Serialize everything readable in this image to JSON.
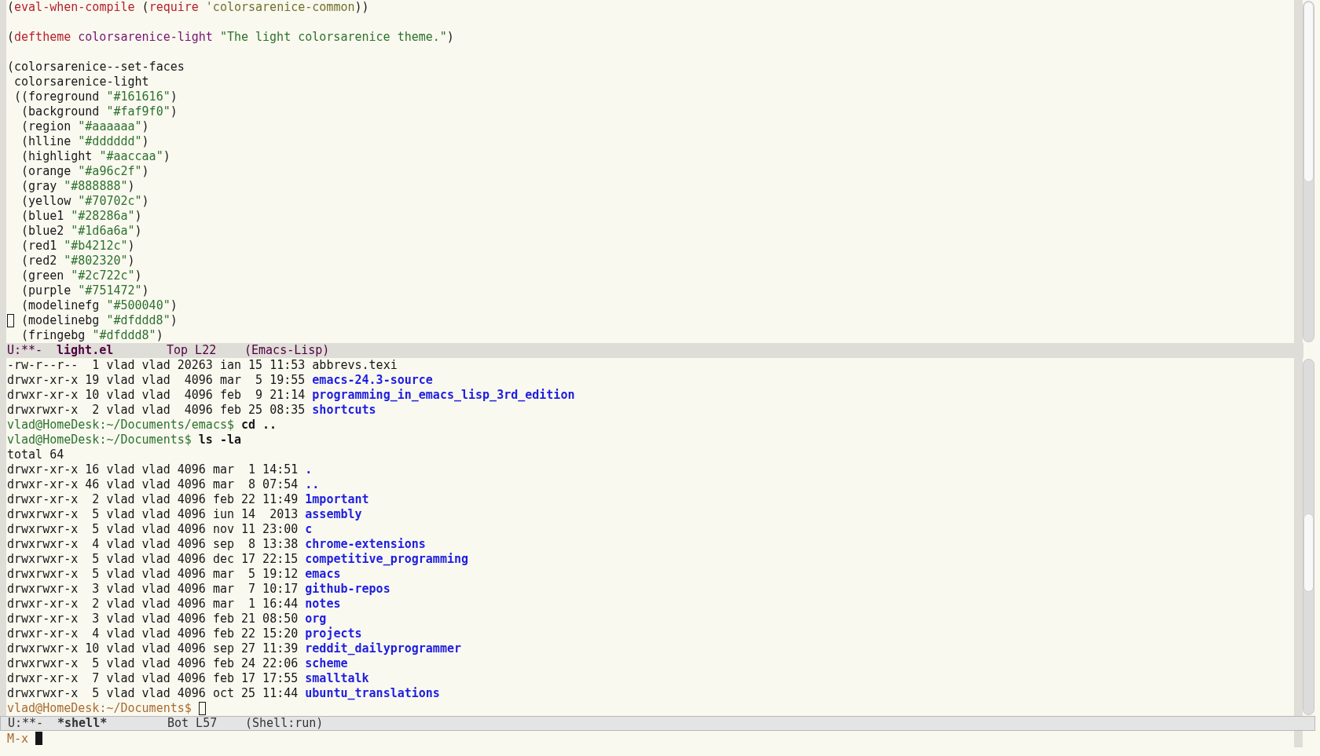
{
  "editor": {
    "lines": [
      {
        "kind": "code",
        "tokens": [
          {
            "kind": "plain",
            "text": "("
          },
          {
            "kind": "keyword",
            "text": "eval-when-compile"
          },
          {
            "kind": "plain",
            "text": " ("
          },
          {
            "kind": "keyword",
            "text": "require"
          },
          {
            "kind": "space"
          },
          {
            "kind": "quoted",
            "text": "'colorsarenice-common"
          },
          {
            "kind": "plain",
            "text": "))"
          }
        ]
      },
      {
        "kind": "blank"
      },
      {
        "kind": "code",
        "tokens": [
          {
            "kind": "plain",
            "text": "("
          },
          {
            "kind": "keyword",
            "text": "deftheme"
          },
          {
            "kind": "space"
          },
          {
            "kind": "name",
            "text": "colorsarenice-light"
          },
          {
            "kind": "space"
          },
          {
            "kind": "string",
            "text": "\"The light colorsarenice theme.\""
          },
          {
            "kind": "plain",
            "text": ")"
          }
        ]
      },
      {
        "kind": "blank"
      },
      {
        "kind": "code",
        "tokens": [
          {
            "kind": "plain",
            "text": "(colorsarenice--set-faces"
          }
        ]
      },
      {
        "kind": "code",
        "tokens": [
          {
            "kind": "plain",
            "text": " colorsarenice-light"
          }
        ]
      },
      {
        "kind": "code",
        "tokens": [
          {
            "kind": "plain",
            "text": " ((foreground "
          },
          {
            "kind": "string",
            "text": "\"#161616\""
          },
          {
            "kind": "plain",
            "text": ")"
          }
        ]
      },
      {
        "kind": "code",
        "tokens": [
          {
            "kind": "plain",
            "text": "  (background "
          },
          {
            "kind": "string",
            "text": "\"#faf9f0\""
          },
          {
            "kind": "plain",
            "text": ")"
          }
        ]
      },
      {
        "kind": "code",
        "tokens": [
          {
            "kind": "plain",
            "text": "  (region "
          },
          {
            "kind": "string",
            "text": "\"#aaaaaa\""
          },
          {
            "kind": "plain",
            "text": ")"
          }
        ]
      },
      {
        "kind": "code",
        "tokens": [
          {
            "kind": "plain",
            "text": "  (hlline "
          },
          {
            "kind": "string",
            "text": "\"#dddddd\""
          },
          {
            "kind": "plain",
            "text": ")"
          }
        ]
      },
      {
        "kind": "code",
        "tokens": [
          {
            "kind": "plain",
            "text": "  (highlight "
          },
          {
            "kind": "string",
            "text": "\"#aaccaa\""
          },
          {
            "kind": "plain",
            "text": ")"
          }
        ]
      },
      {
        "kind": "code",
        "tokens": [
          {
            "kind": "plain",
            "text": "  (orange "
          },
          {
            "kind": "string",
            "text": "\"#a96c2f\""
          },
          {
            "kind": "plain",
            "text": ")"
          }
        ]
      },
      {
        "kind": "code",
        "tokens": [
          {
            "kind": "plain",
            "text": "  (gray "
          },
          {
            "kind": "string",
            "text": "\"#888888\""
          },
          {
            "kind": "plain",
            "text": ")"
          }
        ]
      },
      {
        "kind": "code",
        "tokens": [
          {
            "kind": "plain",
            "text": "  (yellow "
          },
          {
            "kind": "string",
            "text": "\"#70702c\""
          },
          {
            "kind": "plain",
            "text": ")"
          }
        ]
      },
      {
        "kind": "code",
        "tokens": [
          {
            "kind": "plain",
            "text": "  (blue1 "
          },
          {
            "kind": "string",
            "text": "\"#28286a\""
          },
          {
            "kind": "plain",
            "text": ")"
          }
        ]
      },
      {
        "kind": "code",
        "tokens": [
          {
            "kind": "plain",
            "text": "  (blue2 "
          },
          {
            "kind": "string",
            "text": "\"#1d6a6a\""
          },
          {
            "kind": "plain",
            "text": ")"
          }
        ]
      },
      {
        "kind": "code",
        "tokens": [
          {
            "kind": "plain",
            "text": "  (red1 "
          },
          {
            "kind": "string",
            "text": "\"#b4212c\""
          },
          {
            "kind": "plain",
            "text": ")"
          }
        ]
      },
      {
        "kind": "code",
        "tokens": [
          {
            "kind": "plain",
            "text": "  (red2 "
          },
          {
            "kind": "string",
            "text": "\"#802320\""
          },
          {
            "kind": "plain",
            "text": ")"
          }
        ]
      },
      {
        "kind": "code",
        "tokens": [
          {
            "kind": "plain",
            "text": "  (green "
          },
          {
            "kind": "string",
            "text": "\"#2c722c\""
          },
          {
            "kind": "plain",
            "text": ")"
          }
        ]
      },
      {
        "kind": "code",
        "tokens": [
          {
            "kind": "plain",
            "text": "  (purple "
          },
          {
            "kind": "string",
            "text": "\"#751472\""
          },
          {
            "kind": "plain",
            "text": ")"
          }
        ]
      },
      {
        "kind": "code",
        "tokens": [
          {
            "kind": "plain",
            "text": "  (modelinefg "
          },
          {
            "kind": "string",
            "text": "\"#500040\""
          },
          {
            "kind": "plain",
            "text": ")"
          }
        ]
      },
      {
        "kind": "code",
        "tokens": [
          {
            "kind": "hollow_cursor"
          },
          {
            "kind": "plain",
            "text": " (modelinebg "
          },
          {
            "kind": "string",
            "text": "\"#dfddd8\""
          },
          {
            "kind": "plain",
            "text": ")"
          }
        ]
      },
      {
        "kind": "code",
        "tokens": [
          {
            "kind": "plain",
            "text": "  (fringebg "
          },
          {
            "kind": "string",
            "text": "\"#dfddd8\""
          },
          {
            "kind": "plain",
            "text": ")"
          }
        ]
      }
    ],
    "mode_line": {
      "active": true,
      "state": "U:**-",
      "buffer": "light.el",
      "position": "Top L22",
      "mode": "(Emacs-Lisp)"
    }
  },
  "shell": {
    "lines": [
      {
        "kind": "code",
        "tokens": [
          {
            "kind": "plain",
            "text": "-rw-r--r--  1 vlad vlad 20263 ian 15 11:53 "
          },
          {
            "kind": "file",
            "text": "abbrevs.texi"
          }
        ]
      },
      {
        "kind": "code",
        "tokens": [
          {
            "kind": "plain",
            "text": "drwxr-xr-x 19 vlad vlad  4096 mar  5 19:55 "
          },
          {
            "kind": "dir",
            "text": "emacs-24.3-source"
          }
        ]
      },
      {
        "kind": "code",
        "tokens": [
          {
            "kind": "plain",
            "text": "drwxr-xr-x 10 vlad vlad  4096 feb  9 21:14 "
          },
          {
            "kind": "dir",
            "text": "programming_in_emacs_lisp_3rd_edition"
          }
        ]
      },
      {
        "kind": "code",
        "tokens": [
          {
            "kind": "plain",
            "text": "drwxrwxr-x  2 vlad vlad  4096 feb 25 08:35 "
          },
          {
            "kind": "dir",
            "text": "shortcuts"
          }
        ]
      },
      {
        "kind": "code",
        "tokens": [
          {
            "kind": "prompt",
            "text": "vlad@HomeDesk:~/Documents/emacs$"
          },
          {
            "kind": "space"
          },
          {
            "kind": "command",
            "text": "cd .."
          }
        ]
      },
      {
        "kind": "code",
        "tokens": [
          {
            "kind": "prompt",
            "text": "vlad@HomeDesk:~/Documents$"
          },
          {
            "kind": "space"
          },
          {
            "kind": "command",
            "text": "ls -la"
          }
        ]
      },
      {
        "kind": "code",
        "tokens": [
          {
            "kind": "plain",
            "text": "total 64"
          }
        ]
      },
      {
        "kind": "code",
        "tokens": [
          {
            "kind": "plain",
            "text": "drwxr-xr-x 16 vlad vlad 4096 mar  1 14:51 "
          },
          {
            "kind": "dir",
            "text": "."
          }
        ]
      },
      {
        "kind": "code",
        "tokens": [
          {
            "kind": "plain",
            "text": "drwxr-xr-x 46 vlad vlad 4096 mar  8 07:54 "
          },
          {
            "kind": "dir",
            "text": ".."
          }
        ]
      },
      {
        "kind": "code",
        "tokens": [
          {
            "kind": "plain",
            "text": "drwxr-xr-x  2 vlad vlad 4096 feb 22 11:49 "
          },
          {
            "kind": "dir",
            "text": "1mportant"
          }
        ]
      },
      {
        "kind": "code",
        "tokens": [
          {
            "kind": "plain",
            "text": "drwxrwxr-x  5 vlad vlad 4096 iun 14  2013 "
          },
          {
            "kind": "dir",
            "text": "assembly"
          }
        ]
      },
      {
        "kind": "code",
        "tokens": [
          {
            "kind": "plain",
            "text": "drwxrwxr-x  5 vlad vlad 4096 nov 11 23:00 "
          },
          {
            "kind": "dir",
            "text": "c"
          }
        ]
      },
      {
        "kind": "code",
        "tokens": [
          {
            "kind": "plain",
            "text": "drwxrwxr-x  4 vlad vlad 4096 sep  8 13:38 "
          },
          {
            "kind": "dir",
            "text": "chrome-extensions"
          }
        ]
      },
      {
        "kind": "code",
        "tokens": [
          {
            "kind": "plain",
            "text": "drwxrwxr-x  5 vlad vlad 4096 dec 17 22:15 "
          },
          {
            "kind": "dir",
            "text": "competitive_programming"
          }
        ]
      },
      {
        "kind": "code",
        "tokens": [
          {
            "kind": "plain",
            "text": "drwxrwxr-x  5 vlad vlad 4096 mar  5 19:12 "
          },
          {
            "kind": "dir",
            "text": "emacs"
          }
        ]
      },
      {
        "kind": "code",
        "tokens": [
          {
            "kind": "plain",
            "text": "drwxrwxr-x  3 vlad vlad 4096 mar  7 10:17 "
          },
          {
            "kind": "dir",
            "text": "github-repos"
          }
        ]
      },
      {
        "kind": "code",
        "tokens": [
          {
            "kind": "plain",
            "text": "drwxr-xr-x  2 vlad vlad 4096 mar  1 16:44 "
          },
          {
            "kind": "dir",
            "text": "notes"
          }
        ]
      },
      {
        "kind": "code",
        "tokens": [
          {
            "kind": "plain",
            "text": "drwxr-xr-x  3 vlad vlad 4096 feb 21 08:50 "
          },
          {
            "kind": "dir",
            "text": "org"
          }
        ]
      },
      {
        "kind": "code",
        "tokens": [
          {
            "kind": "plain",
            "text": "drwxr-xr-x  4 vlad vlad 4096 feb 22 15:20 "
          },
          {
            "kind": "dir",
            "text": "projects"
          }
        ]
      },
      {
        "kind": "code",
        "tokens": [
          {
            "kind": "plain",
            "text": "drwxrwxr-x 10 vlad vlad 4096 sep 27 11:39 "
          },
          {
            "kind": "dir",
            "text": "reddit_dailyprogrammer"
          }
        ]
      },
      {
        "kind": "code",
        "tokens": [
          {
            "kind": "plain",
            "text": "drwxrwxr-x  5 vlad vlad 4096 feb 24 22:06 "
          },
          {
            "kind": "dir",
            "text": "scheme"
          }
        ]
      },
      {
        "kind": "code",
        "tokens": [
          {
            "kind": "plain",
            "text": "drwxr-xr-x  7 vlad vlad 4096 feb 17 17:55 "
          },
          {
            "kind": "dir",
            "text": "smalltalk"
          }
        ]
      },
      {
        "kind": "code",
        "tokens": [
          {
            "kind": "plain",
            "text": "drwxrwxr-x  5 vlad vlad 4096 oct 25 11:44 "
          },
          {
            "kind": "dir",
            "text": "ubuntu_translations"
          }
        ]
      },
      {
        "kind": "code",
        "tokens": [
          {
            "kind": "current_prompt",
            "text": "vlad@HomeDesk:~/Documents$"
          },
          {
            "kind": "space"
          },
          {
            "kind": "hollow_cursor"
          }
        ]
      }
    ],
    "mode_line": {
      "active": false,
      "state": "U:**-",
      "buffer": "*shell*",
      "position": "Bot L57",
      "mode": "(Shell:run)"
    }
  },
  "minibuffer": {
    "tokens": [
      {
        "kind": "current_prompt",
        "text": "M-x"
      },
      {
        "kind": "space"
      },
      {
        "kind": "filled_cursor"
      }
    ]
  }
}
